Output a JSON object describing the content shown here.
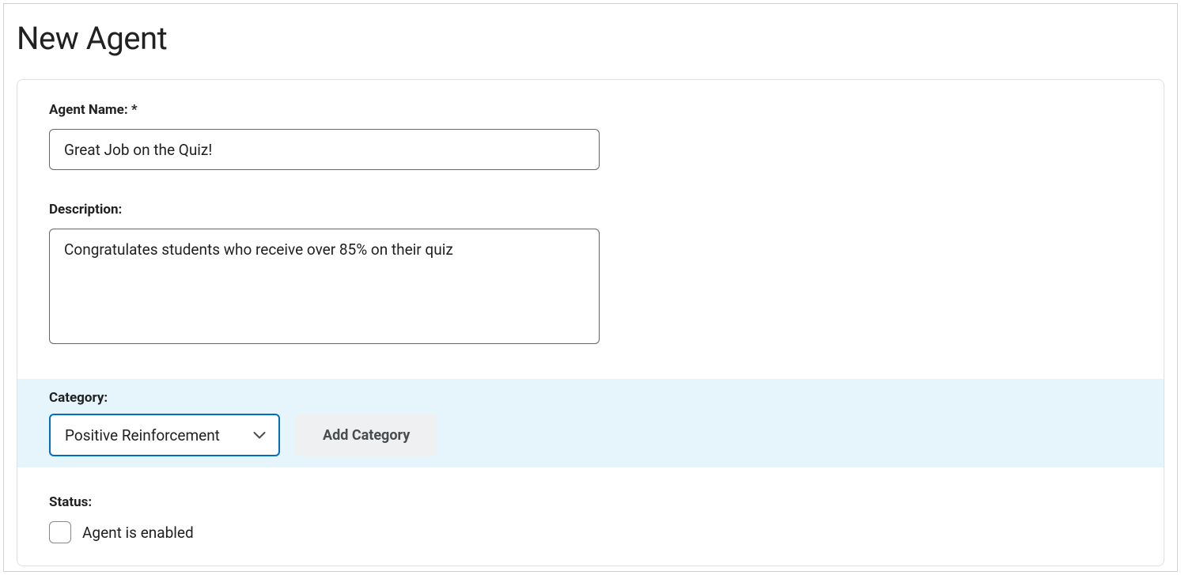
{
  "page": {
    "title": "New Agent"
  },
  "fields": {
    "agent_name": {
      "label": "Agent Name: *",
      "value": "Great Job on the Quiz!"
    },
    "description": {
      "label": "Description:",
      "value": "Congratulates students who receive over 85% on their quiz"
    },
    "category": {
      "label": "Category:",
      "selected": "Positive Reinforcement",
      "add_button": "Add Category"
    },
    "status": {
      "label": "Status:",
      "checkbox_label": "Agent is enabled",
      "checked": false
    }
  }
}
